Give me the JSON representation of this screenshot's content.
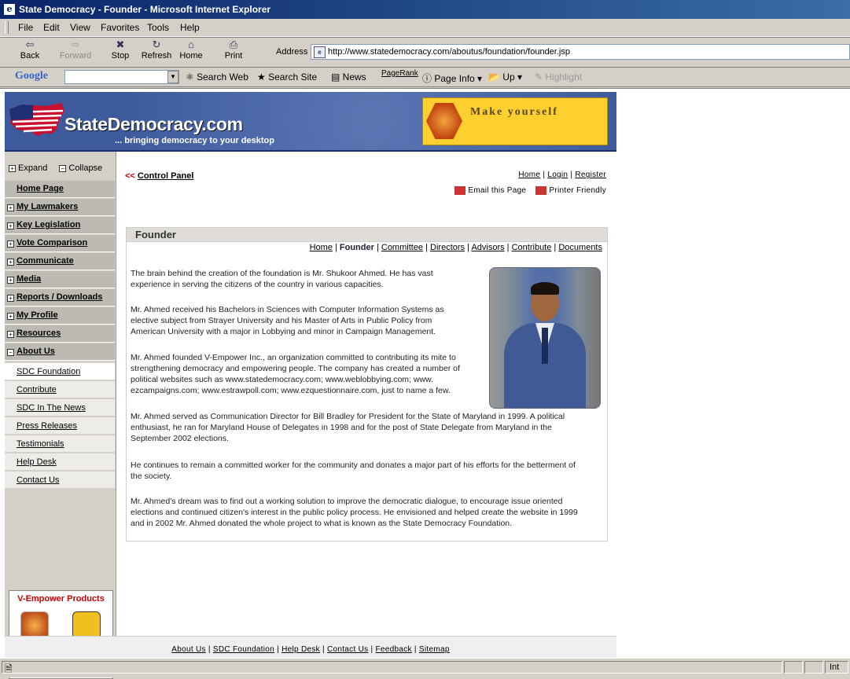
{
  "window": {
    "title": "State Democracy - Founder - Microsoft Internet Explorer"
  },
  "menu": [
    "File",
    "Edit",
    "View",
    "Favorites",
    "Tools",
    "Help"
  ],
  "toolbar": {
    "back": "Back",
    "forward": "Forward",
    "stop": "Stop",
    "refresh": "Refresh",
    "home": "Home",
    "print": "Print",
    "address_label": "Address",
    "url": "http://www.statedemocracy.com/aboutus/foundation/founder.jsp"
  },
  "googlebar": {
    "logo": "Google",
    "search_web": "Search Web",
    "search_site": "Search Site",
    "news": "News",
    "pagerank": "PageRank",
    "page_info": "Page Info",
    "up": "Up",
    "highlight": "Highlight"
  },
  "site": {
    "logo": "StateDemocracy.com",
    "tagline": "... bringing democracy to your desktop",
    "banner": "Make yourself"
  },
  "sidebar": {
    "expand": "Expand",
    "collapse": "Collapse",
    "items": [
      "Home Page",
      "My Lawmakers",
      "Key Legislation",
      "Vote Comparison",
      "Communicate",
      "Media",
      "Reports / Downloads",
      "My Profile",
      "Resources",
      "About Us"
    ],
    "sub_items": [
      "SDC Foundation",
      "Contribute",
      "SDC In The News",
      "Press Releases",
      "Testimonials",
      "Help Desk",
      "Contact Us"
    ],
    "products_title": "V-Empower Products"
  },
  "content": {
    "control_panel": "Control Panel",
    "top_links": [
      "Home",
      "Login",
      "Register"
    ],
    "email": "Email this Page",
    "printer": "Printer Friendly",
    "heading": "Founder",
    "subnav": [
      "Home",
      "Founder",
      "Committee",
      "Directors",
      "Advisors",
      "Contribute",
      "Documents"
    ],
    "paragraphs": [
      [
        "The brain behind the creation of the foundation is Mr. Shukoor Ahmed. He has vast",
        "experience in serving the citizens of the country in various capacities."
      ],
      [
        "Mr. Ahmed received his Bachelors in Sciences with Computer Information Systems as",
        "elective subject from Strayer University and his Master of Arts in Public Policy from",
        "American University with a major in Lobbying and minor in Campaign Management."
      ],
      [
        "Mr. Ahmed founded V-Empower Inc., an organization committed to contributing its mite to",
        "strengthening democracy and empowering people. The company has created a number of",
        "political websites such as www.statedemocracy.com; www.weblobbying.com; www.",
        "ezcampaigns.com; www.estrawpoll.com; www.ezquestionnaire.com, just to name a few."
      ],
      [
        "Mr. Ahmed served as Communication Director for Bill Bradley for President for the State of Maryland in 1999. A political",
        "enthusiast, he ran for Maryland House of Delegates in 1998 and for the post of State Delegate from Maryland in the",
        "September 2002 elections."
      ],
      [
        "He continues to remain a committed worker for the community and donates a major part of his efforts for the betterment of",
        "the society."
      ],
      [
        "Mr. Ahmed's dream was to find out a working solution to improve the democratic dialogue, to encourage issue oriented",
        "elections and continued citizen's interest in the public policy process. He envisioned and helped create the website in 1999",
        "and in 2002 Mr. Ahmed donated the whole project to what is known as the State Democracy Foundation."
      ]
    ]
  },
  "footer": [
    "About Us",
    "SDC Foundation",
    "Help Desk",
    "Contact Us",
    "Feedback",
    "Sitemap"
  ],
  "status": {
    "zone": "Int"
  }
}
